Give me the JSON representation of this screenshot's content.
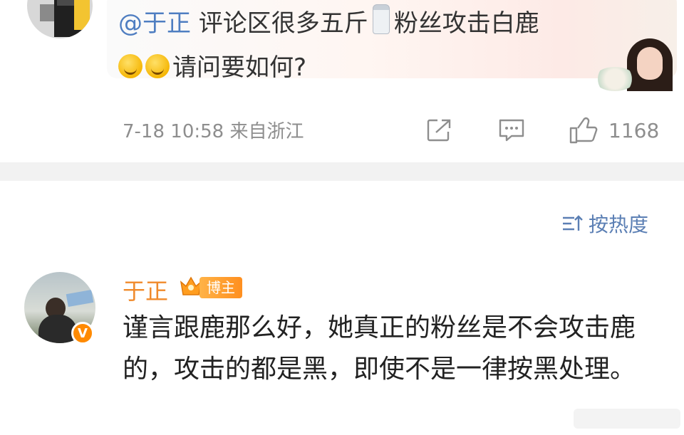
{
  "post": {
    "mention": "@于正",
    "text_before_emoji": " 评论区很多五斤",
    "text_after_emoji": "粉丝攻击白鹿",
    "line2_text": "请问要如何?",
    "emojis": [
      "salt-shaker-emoji",
      "sweat-smile-emoji",
      "sweat-smile-emoji"
    ],
    "timestamp": "7-18 10:58",
    "location": "来自浙江",
    "like_count": "1168"
  },
  "sort": {
    "label": "按热度"
  },
  "comment": {
    "author": "于正",
    "badge": "博主",
    "text": "谨言跟鹿那么好，她真正的粉丝是不会攻击鹿的，攻击的都是黑，即使不是一律按黑处理。"
  },
  "colors": {
    "mention": "#4f7ec1",
    "author": "#f08a2b",
    "badge": "#ff8f1f",
    "meta_gray": "#8e8e8e",
    "sort_blue": "#5b7fb4"
  }
}
